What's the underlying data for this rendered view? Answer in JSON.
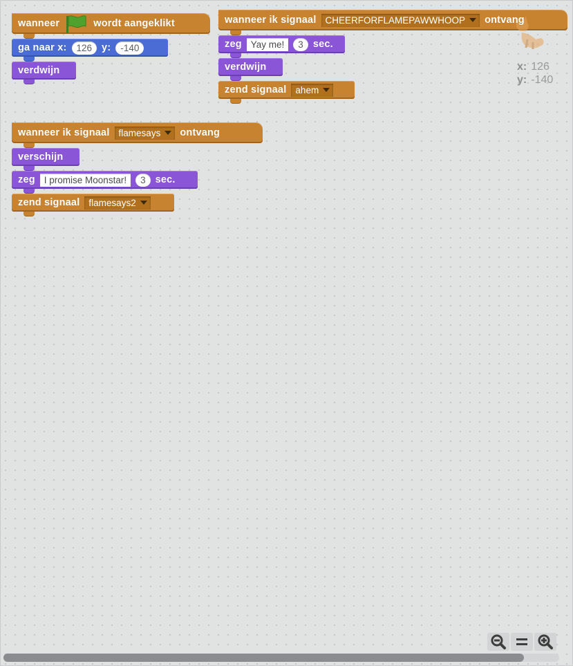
{
  "scripts": {
    "green_flag": {
      "hat": {
        "when": "wanneer",
        "clicked": "wordt aangeklikt"
      },
      "goto": {
        "label": "ga naar x:",
        "y_label": "y:",
        "x": "126",
        "y": "-140"
      },
      "hide": "verdwijn"
    },
    "cheer": {
      "hat": {
        "when": "wanneer ik signaal",
        "message": "CHEERFORFLAMEPAWWHOOP",
        "receive": "ontvang"
      },
      "say": {
        "label": "zeg",
        "text": "Yay me!",
        "secs": "3",
        "secs_label": "sec."
      },
      "hide": "verdwijn",
      "broadcast": {
        "label": "zend signaal",
        "message": "ahem"
      }
    },
    "flamesays": {
      "hat": {
        "when": "wanneer ik signaal",
        "message": "flamesays",
        "receive": "ontvang"
      },
      "show": "verschijn",
      "say": {
        "label": "zeg",
        "text": "I promise Moonstar!",
        "secs": "3",
        "secs_label": "sec."
      },
      "broadcast": {
        "label": "zend signaal",
        "message": "flamesays2"
      }
    }
  },
  "sprite": {
    "x_label": "x:",
    "x": "126",
    "y_label": "y:",
    "y": "-140"
  },
  "colors": {
    "events": "#c88330",
    "motion": "#4a6cd4",
    "looks": "#8a55d7",
    "workspace": "#e1e2e2"
  },
  "icons": {
    "flag": "green-flag-icon",
    "zoom_out": "zoom-out-icon",
    "zoom_reset": "zoom-reset-icon",
    "zoom_in": "zoom-in-icon"
  }
}
